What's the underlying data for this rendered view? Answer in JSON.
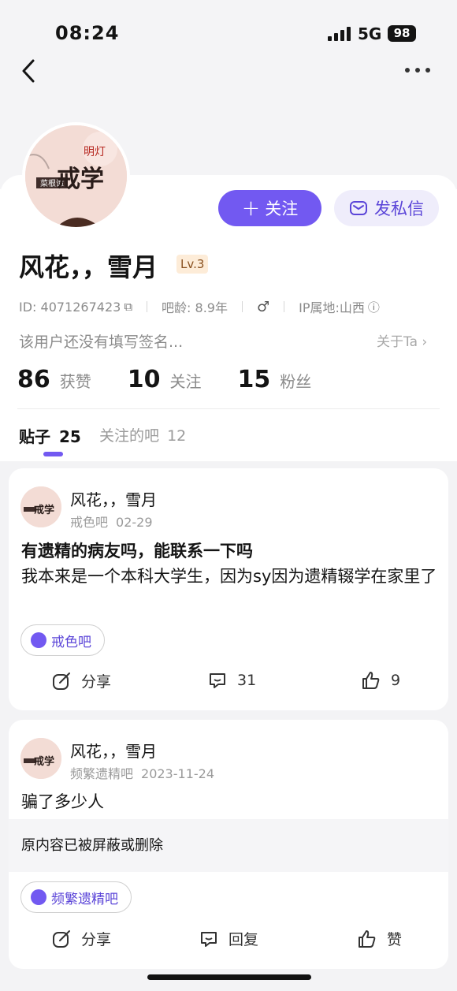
{
  "status_bar": {
    "time": "08:24",
    "network": "5G",
    "battery": "98"
  },
  "profile": {
    "name": "风花，，雪月",
    "level": "Lv.3",
    "id_text": "ID: 4071267423",
    "age_text": "吧龄: 8.9年",
    "ip_text": "IP属地:山西",
    "signature": "该用户还没有填写签名...",
    "about_label": "关于Ta",
    "follow_label": "关注",
    "message_label": "发私信",
    "avatar_text": {
      "main": "戒学",
      "sub": "明灯",
      "badge": "菜根谭"
    }
  },
  "stats": [
    {
      "num": "86",
      "label": "获赞"
    },
    {
      "num": "10",
      "label": "关注"
    },
    {
      "num": "15",
      "label": "粉丝"
    }
  ],
  "tabs": [
    {
      "label": "贴子",
      "count": "25"
    },
    {
      "label": "关注的吧",
      "count": "12"
    }
  ],
  "posts": [
    {
      "author": "风花，，雪月",
      "forum": "戒色吧",
      "date": "02-29",
      "title": "有遗精的病友吗，能联系一下吗",
      "body": "我本来是一个本科大学生，因为sy因为遗精辍学在家里了",
      "tag": "戒色吧",
      "share_label": "分享",
      "comment_count": "31",
      "like_count": "9"
    },
    {
      "author": "风花，，雪月",
      "forum": "频繁遗精吧",
      "date": "2023-11-24",
      "body": "骗了多少人",
      "blocked_text": "原内容已被屏蔽或删除",
      "tag": "频繁遗精吧",
      "share_label": "分享",
      "reply_label": "回复",
      "like_label": "赞"
    }
  ],
  "colors": {
    "accent": "#7259f1",
    "accent_light": "#efedfb",
    "level_bg": "#fdecd8"
  }
}
